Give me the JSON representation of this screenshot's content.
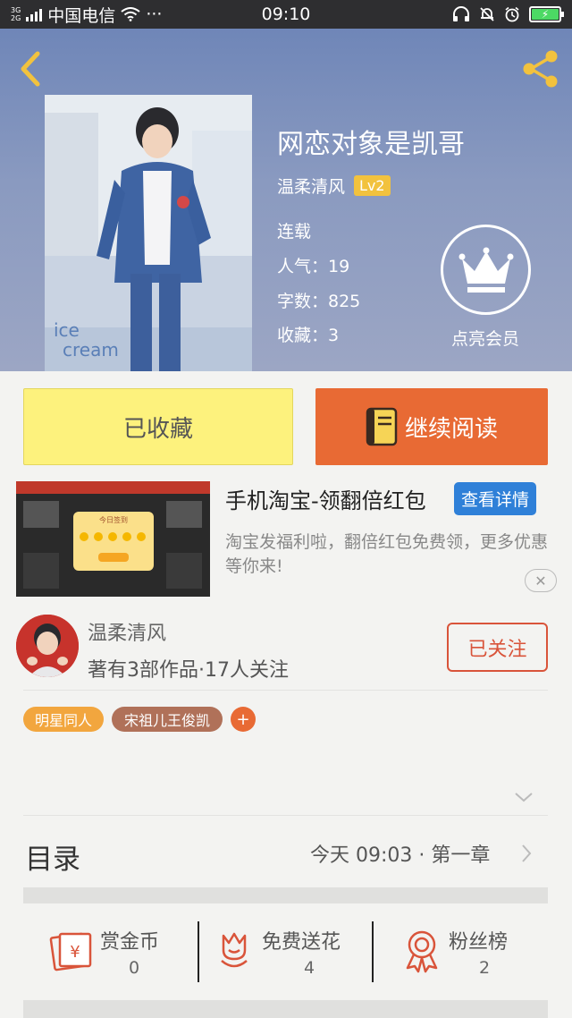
{
  "status_bar": {
    "net_top": "3G",
    "net_bottom": "2G",
    "carrier": "中国电信",
    "more": "···",
    "time": "09:10"
  },
  "book": {
    "title": "网恋对象是凯哥",
    "author": "温柔清风",
    "level": "Lv2",
    "status": "连载",
    "popularity": "人气：19",
    "word_count": "字数：825",
    "favorites": "收藏：3",
    "vip_label": "点亮会员"
  },
  "actions": {
    "favorited": "已收藏",
    "continue_reading": "继续阅读"
  },
  "ad": {
    "title": "手机淘宝-领翻倍红包",
    "detail_button": "查看详情",
    "description": "淘宝发福利啦，翻倍红包免费领，更多优惠等你来!",
    "close": "✕",
    "thumb_text": "今日签到"
  },
  "author_card": {
    "name": "温柔清风",
    "stats": "著有3部作品·17人关注",
    "follow_button": "已关注"
  },
  "tags": [
    "明星同人",
    "宋祖儿王俊凯"
  ],
  "tag_add": "+",
  "catalog": {
    "title": "目录",
    "latest": "今天 09:03 · 第一章"
  },
  "bottom_stats": [
    {
      "label": "赏金币",
      "value": "0",
      "icon": "coin-envelope-icon"
    },
    {
      "label": "免费送花",
      "value": "4",
      "icon": "flower-icon"
    },
    {
      "label": "粉丝榜",
      "value": "2",
      "icon": "ribbon-medal-icon"
    }
  ],
  "colors": {
    "accent_orange": "#e86a34",
    "fav_yellow": "#fdf27d",
    "link_blue": "#2f80d8",
    "tag_orange": "#f2a63e",
    "tag_brown": "#b07159",
    "icon_red": "#d9543a"
  }
}
